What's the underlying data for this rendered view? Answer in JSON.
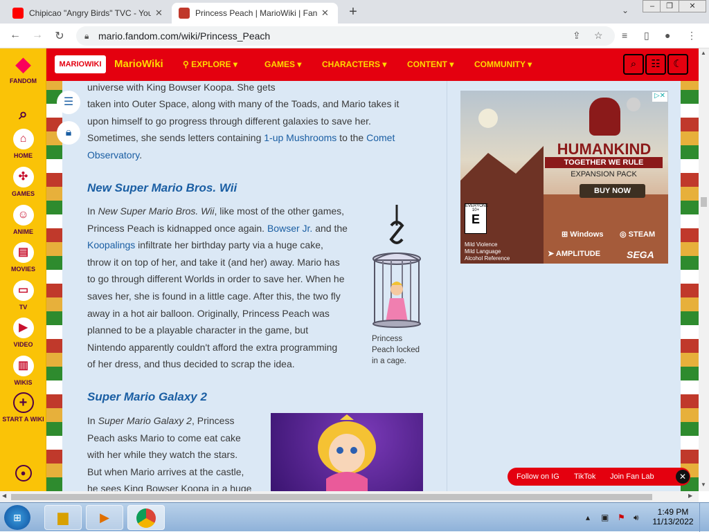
{
  "browser": {
    "tabs": [
      {
        "title": "Chipicao \"Angry Birds\" TVC - You",
        "favicon_color": "#ff0000",
        "active": false
      },
      {
        "title": "Princess Peach | MarioWiki | Fand",
        "favicon_color": "#c0392b",
        "active": true
      }
    ],
    "url": "mario.fandom.com/wiki/Princess_Peach",
    "new_tab_label": "+"
  },
  "fandom_sidebar": {
    "logo_label": "FANDOM",
    "items": [
      {
        "label": "HOME",
        "icon": "home-icon"
      },
      {
        "label": "GAMES",
        "icon": "gamepad-icon"
      },
      {
        "label": "ANIME",
        "icon": "anime-icon"
      },
      {
        "label": "MOVIES",
        "icon": "movie-icon"
      },
      {
        "label": "TV",
        "icon": "tv-icon"
      },
      {
        "label": "VIDEO",
        "icon": "play-icon"
      },
      {
        "label": "WIKIS",
        "icon": "book-icon"
      },
      {
        "label": "START A WIKI",
        "icon": "plus-icon"
      }
    ]
  },
  "wiki_header": {
    "logo_text": "MARIOWIKI",
    "wiki_name": "MarioWiki",
    "nav": [
      {
        "label": "EXPLORE"
      },
      {
        "label": "GAMES"
      },
      {
        "label": "CHARACTERS"
      },
      {
        "label": "CONTENT"
      },
      {
        "label": "COMMUNITY"
      }
    ]
  },
  "article": {
    "intro_line": "universe with King Bowser Koopa. She gets",
    "intro_para": [
      "taken into Outer Space, along with many of the Toads, and Mario takes it",
      "upon himself to go progress through different galaxies to save her.",
      "Sometimes, she sends letters containing ",
      "1-up Mushrooms",
      " to the ",
      "Comet",
      "Observatory",
      "."
    ],
    "section1_title": "New Super Mario Bros. Wii",
    "section1_lines": [
      [
        "In ",
        "New Super Mario Bros. Wii",
        ", like most of the other games,"
      ],
      [
        "Princess Peach is kidnapped once again. ",
        "Bowser Jr.",
        " and the"
      ],
      [
        "Koopalings",
        " infiltrate her birthday party via a huge cake,"
      ],
      [
        "throw it on top of her, and take it (and her) away. Mario has"
      ],
      [
        "to go through different Worlds in order to save her. When he"
      ],
      [
        "saves her, she is found in a little cage. After this, the two fly"
      ],
      [
        "away in a hot air balloon. Originally, Princess Peach was"
      ],
      [
        "planned to be a playable character in the game, but"
      ],
      [
        "Nintendo apparently couldn't afford the extra programming"
      ],
      [
        "of her dress, and thus decided to scrap the idea."
      ]
    ],
    "caption": "Princess Peach locked in a cage.",
    "section2_title": "Super Mario Galaxy 2",
    "section2_lines": [
      [
        "In ",
        "Super Mario Galaxy 2",
        ", Princess"
      ],
      [
        "Peach asks Mario to come eat cake"
      ],
      [
        "with her while they watch the stars."
      ],
      [
        "But when Mario arrives at the castle,"
      ],
      [
        "he sees King Bowser Koopa in a huge"
      ]
    ]
  },
  "ad": {
    "brand": "HUMANKIND",
    "tagline": "TOGETHER WE RULE",
    "expansion": "EXPANSION PACK",
    "cta": "BUY NOW",
    "platforms": [
      "Windows",
      "STEAM"
    ],
    "publisher": "AMPLITUDE",
    "sega": "SEGA",
    "rating_lines": [
      "Mild Violence",
      "Mild Language",
      "Alcohol Reference"
    ],
    "rating_label": "EVERYONE 10+"
  },
  "social_bar": {
    "items": [
      "Follow on IG",
      "TikTok",
      "Join Fan Lab"
    ]
  },
  "taskbar": {
    "time": "1:49 PM",
    "date": "11/13/2022"
  },
  "colors": {
    "fandom_yellow": "#fac307",
    "wiki_red": "#e4000f",
    "nav_yellow": "#ffd900",
    "link_blue": "#1a5ea3",
    "content_bg": "#dbe8f5"
  }
}
